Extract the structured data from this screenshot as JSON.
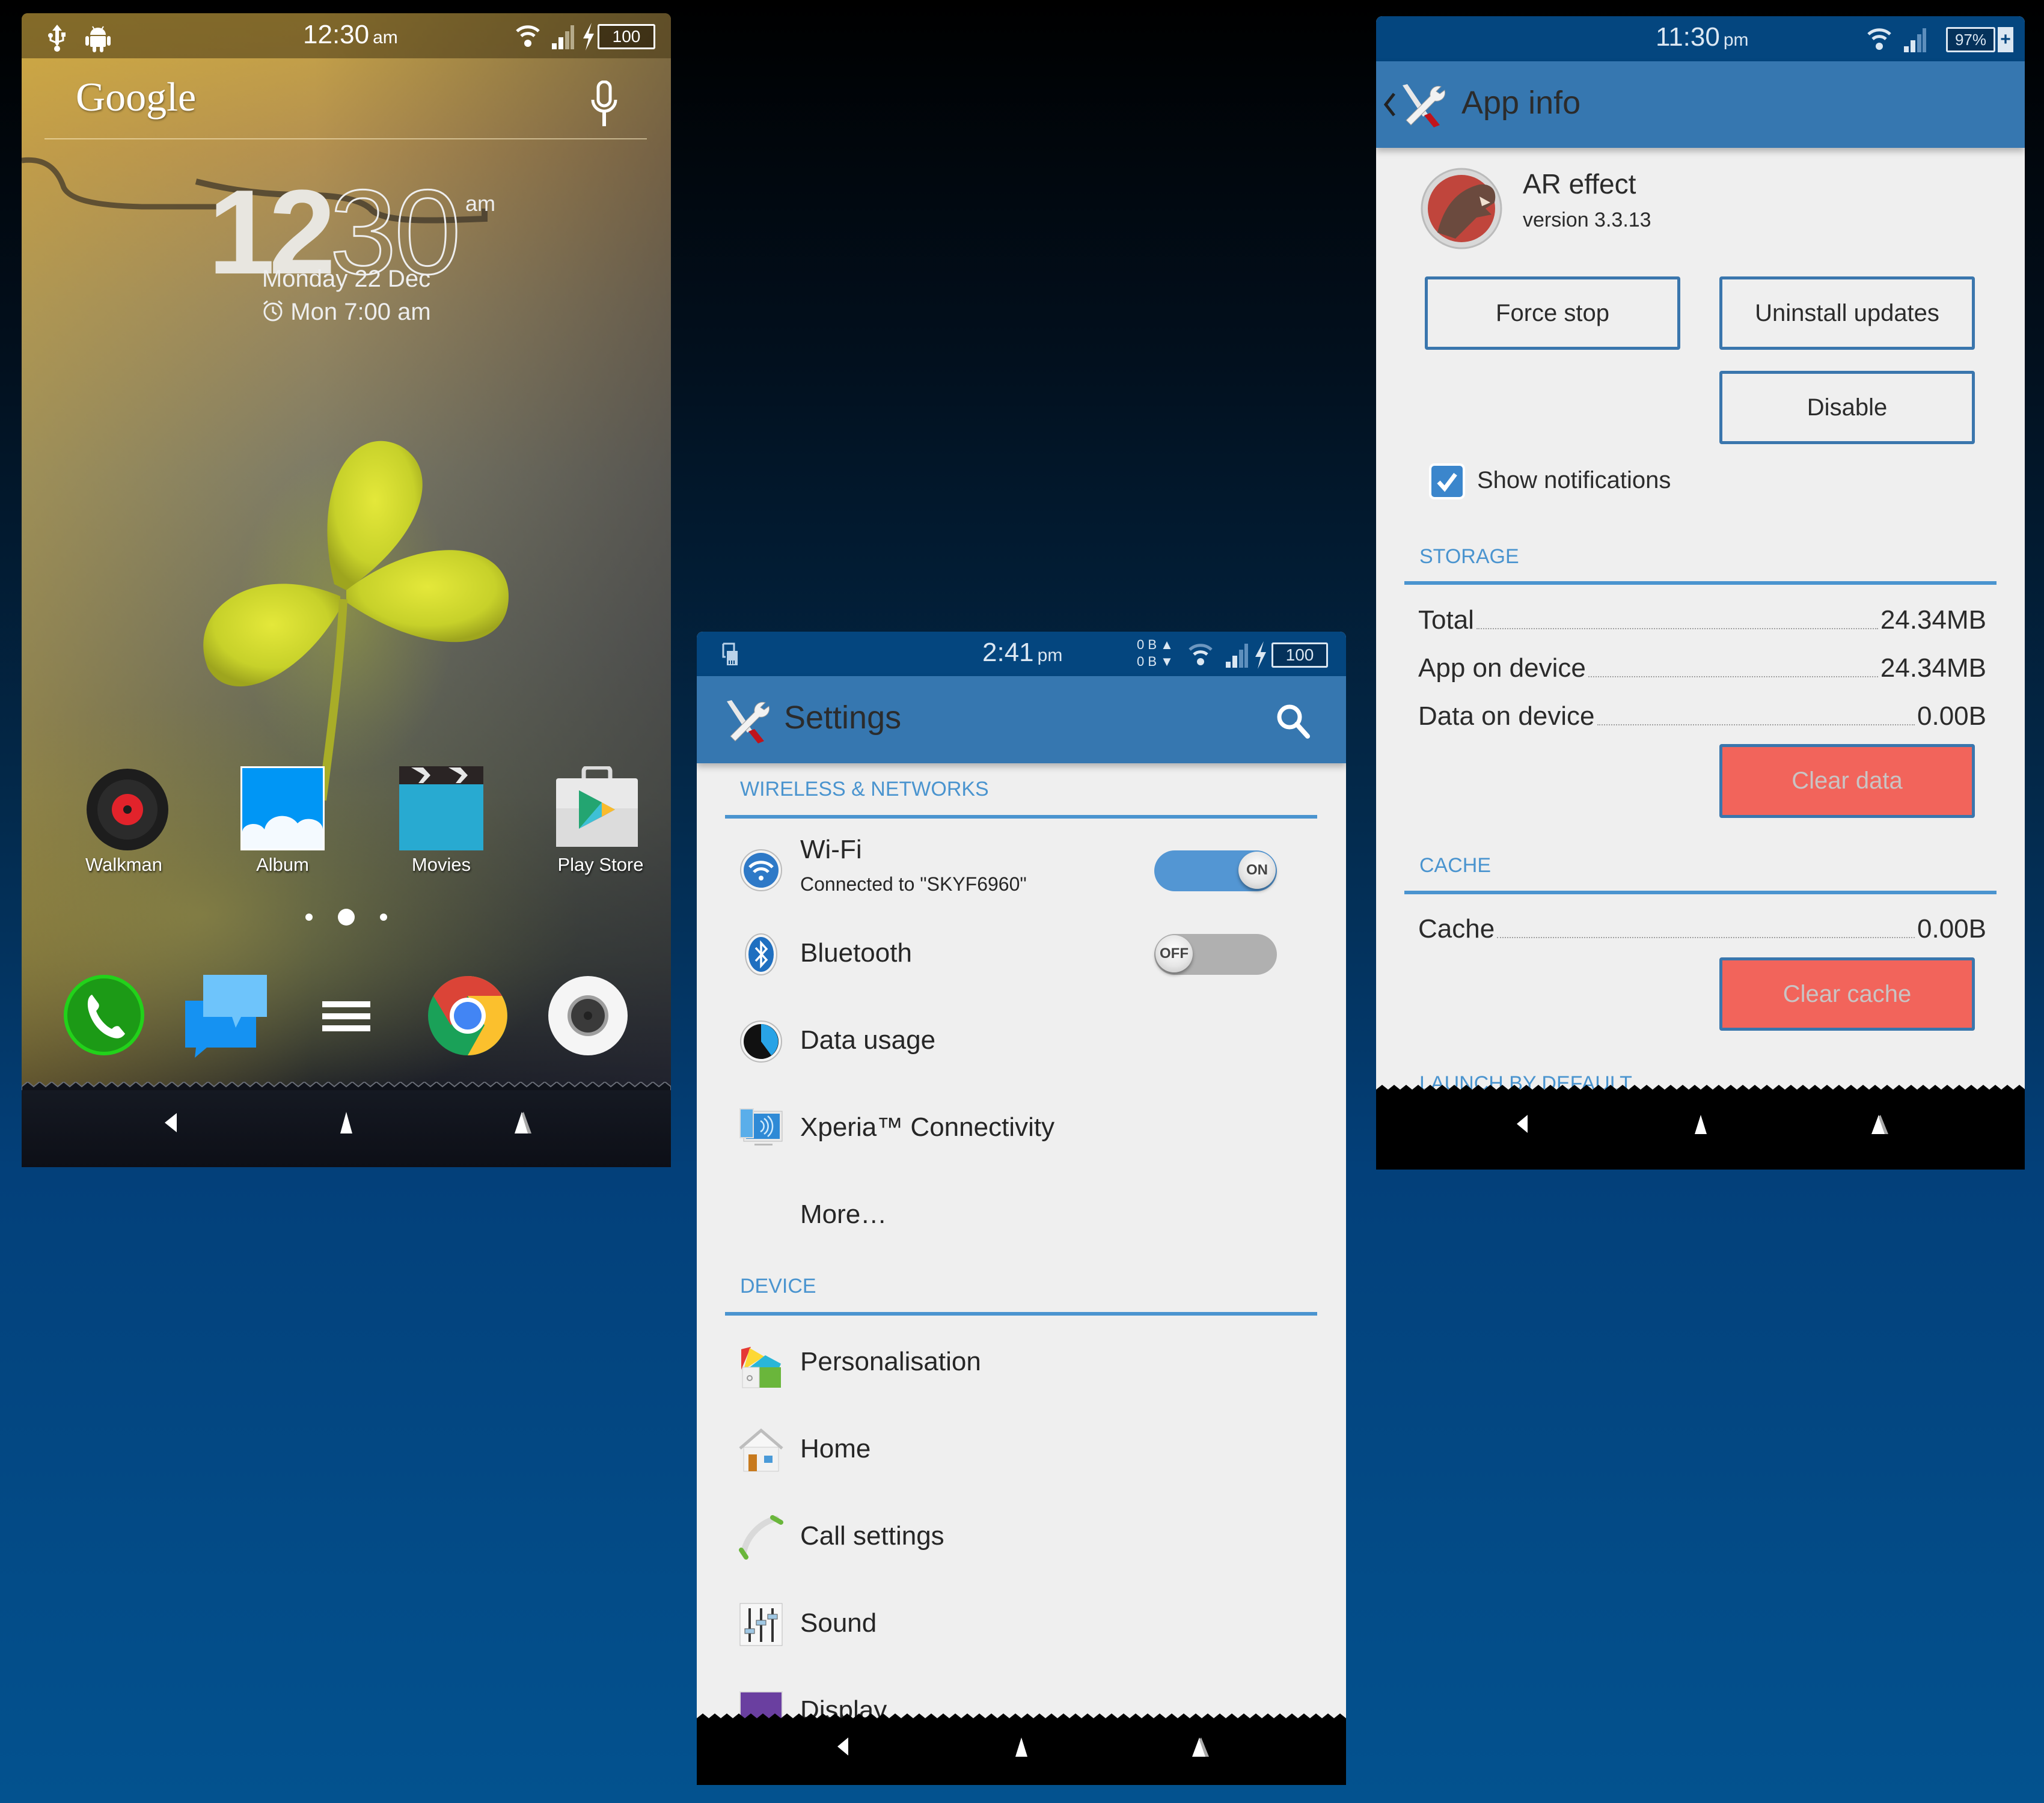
{
  "home": {
    "status_bar": {
      "time": "12:30",
      "time_suffix": "am",
      "battery": "100",
      "left_icons": [
        "usb-icon",
        "android-debug-icon"
      ],
      "right_icons": [
        "wifi-icon",
        "signal-icon",
        "charging-icon",
        "battery-icon"
      ]
    },
    "search": {
      "logo": "Google",
      "mic_icon": "microphone-icon"
    },
    "clock": {
      "hour": "12",
      "minute": "30",
      "ampm": "am",
      "date": "Monday 22 Dec",
      "alarm": "Mon 7:00 am"
    },
    "apps": [
      {
        "label": "Walkman",
        "icon": "walkman-icon"
      },
      {
        "label": "Album",
        "icon": "album-icon"
      },
      {
        "label": "Movies",
        "icon": "movies-icon"
      },
      {
        "label": "Play Store",
        "icon": "play-store-icon"
      }
    ],
    "page_indicator": {
      "pages": 3,
      "current": 2
    },
    "dock": [
      {
        "name": "phone",
        "icon": "phone-icon"
      },
      {
        "name": "messaging",
        "icon": "messaging-icon"
      },
      {
        "name": "app-drawer",
        "icon": "app-drawer-icon"
      },
      {
        "name": "chrome",
        "icon": "chrome-icon"
      },
      {
        "name": "camera",
        "icon": "camera-icon"
      }
    ],
    "nav": [
      "back",
      "home",
      "recents"
    ]
  },
  "settings": {
    "status_bar": {
      "time": "2:41",
      "time_suffix": "pm",
      "data_up": "0 B",
      "data_down": "0 B",
      "battery": "100",
      "left_icons": [
        "sd-card-icon"
      ]
    },
    "title": "Settings",
    "sections": [
      {
        "header": "WIRELESS & NETWORKS",
        "items": [
          {
            "title": "Wi-Fi",
            "subtitle": "Connected to \"SKYF6960\"",
            "icon": "wifi-icon",
            "toggle": "ON"
          },
          {
            "title": "Bluetooth",
            "icon": "bluetooth-icon",
            "toggle": "OFF"
          },
          {
            "title": "Data usage",
            "icon": "data-usage-icon"
          },
          {
            "title": "Xperia™ Connectivity",
            "icon": "xperia-connectivity-icon"
          },
          {
            "title": "More…"
          }
        ]
      },
      {
        "header": "DEVICE",
        "items": [
          {
            "title": "Personalisation",
            "icon": "personalisation-icon"
          },
          {
            "title": "Home",
            "icon": "home-icon"
          },
          {
            "title": "Call settings",
            "icon": "call-settings-icon"
          },
          {
            "title": "Sound",
            "icon": "sound-icon"
          },
          {
            "title": "Display",
            "icon": "display-icon"
          }
        ]
      }
    ],
    "nav": [
      "back",
      "home",
      "recents"
    ]
  },
  "appinfo": {
    "status_bar": {
      "time": "11:30",
      "time_suffix": "pm",
      "battery": "97%"
    },
    "title": "App info",
    "app": {
      "name": "AR effect",
      "version": "version 3.3.13"
    },
    "buttons": {
      "force_stop": "Force stop",
      "uninstall_updates": "Uninstall updates",
      "disable": "Disable",
      "clear_data": "Clear data",
      "clear_cache": "Clear cache"
    },
    "show_notifications": {
      "label": "Show notifications",
      "checked": true
    },
    "storage": {
      "header": "STORAGE",
      "rows": [
        {
          "label": "Total",
          "value": "24.34MB"
        },
        {
          "label": "App on device",
          "value": "24.34MB"
        },
        {
          "label": "Data on device",
          "value": "0.00B"
        }
      ]
    },
    "cache": {
      "header": "CACHE",
      "rows": [
        {
          "label": "Cache",
          "value": "0.00B"
        }
      ]
    },
    "next_section_header": "LAUNCH BY DEFAULT",
    "nav": [
      "back",
      "home",
      "recents"
    ]
  },
  "colors": {
    "status_blue": "#04467f",
    "actionbar_blue": "#3677b0",
    "accent_blue": "#4a94cf",
    "clear_red": "#f2645b",
    "panel_bg": "#efefef"
  }
}
